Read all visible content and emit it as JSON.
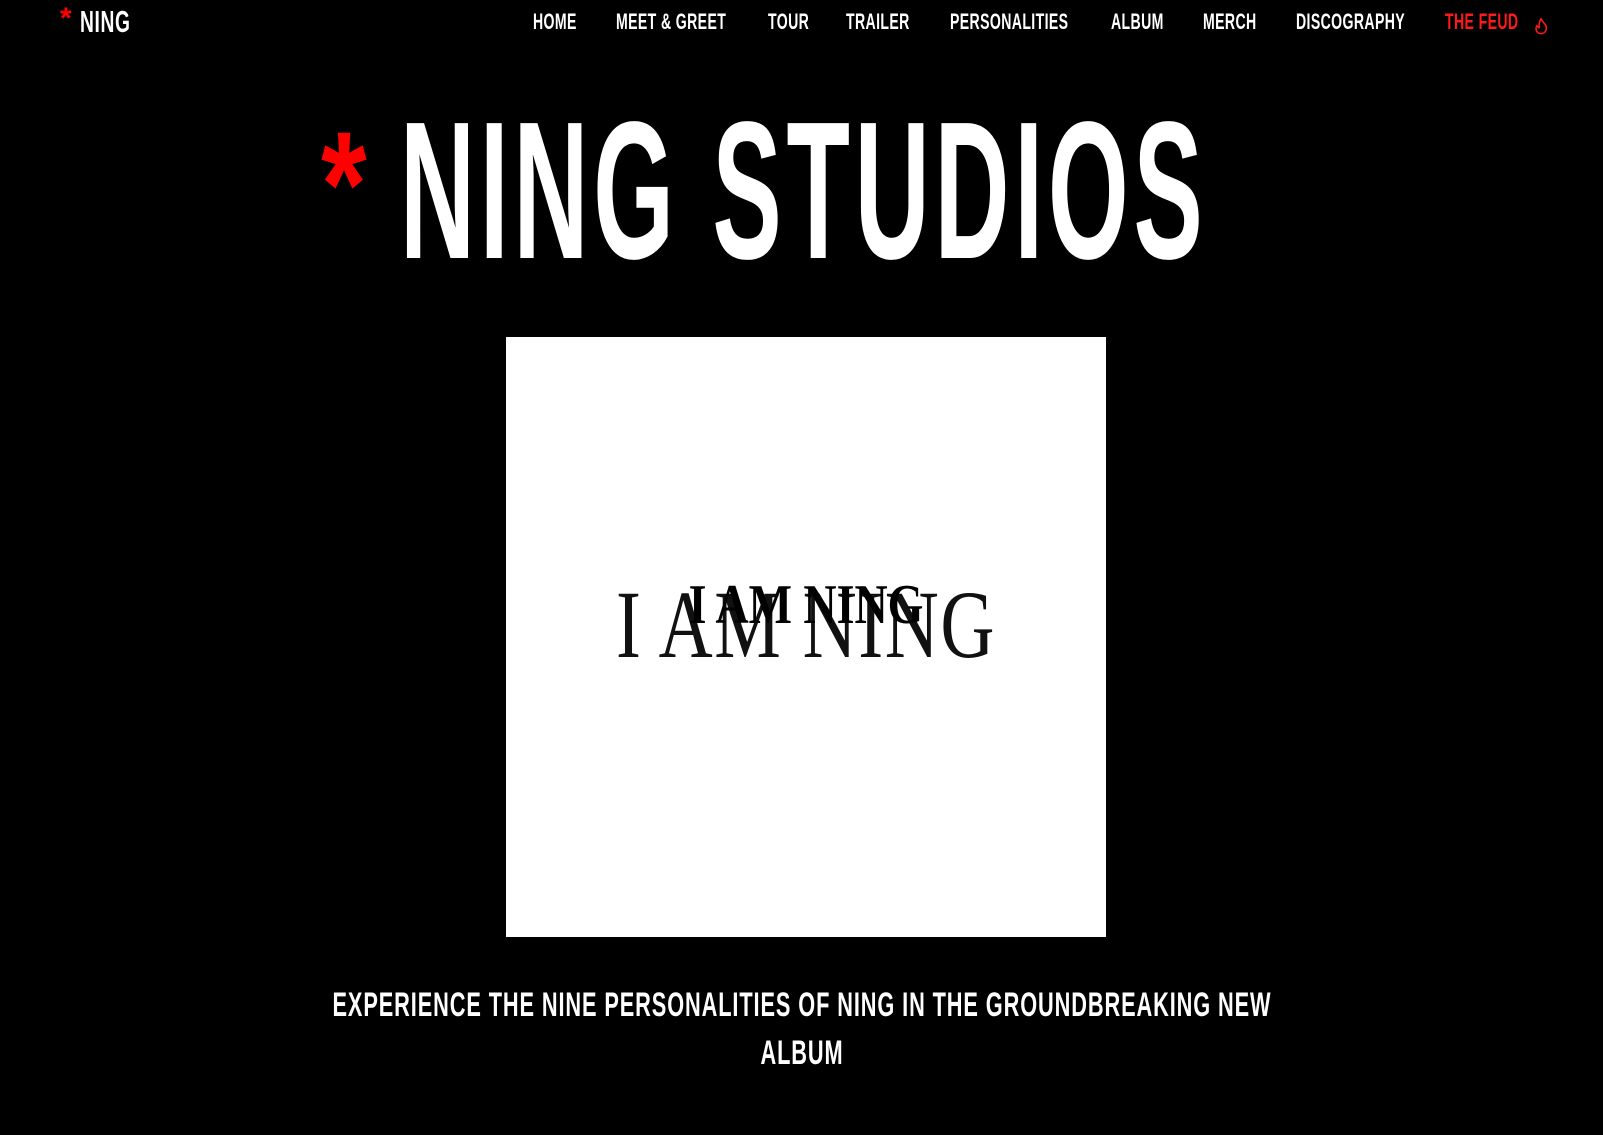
{
  "header": {
    "logo_star": "*",
    "logo_text": "NING",
    "nav": [
      {
        "label": "HOME"
      },
      {
        "label": "MEET & GREET"
      },
      {
        "label": "TOUR"
      },
      {
        "label": "TRAILER"
      },
      {
        "label": "PERSONALITIES"
      },
      {
        "label": "ALBUM"
      },
      {
        "label": "MERCH"
      },
      {
        "label": "DISCOGRAPHY"
      },
      {
        "label": "THE FEUD",
        "icon": "flame-icon",
        "color": "#ff1a1a"
      }
    ]
  },
  "hero": {
    "star": "*",
    "title": "NING STUDIOS",
    "star_color": "#ff0000"
  },
  "album": {
    "cover_text": "I AM NING",
    "background": "#ffffff"
  },
  "tagline": {
    "line1": "EXPERIENCE THE NINE PERSONALITIES OF NING IN THE GROUNDBREAKING NEW",
    "line2": "ALBUM"
  }
}
